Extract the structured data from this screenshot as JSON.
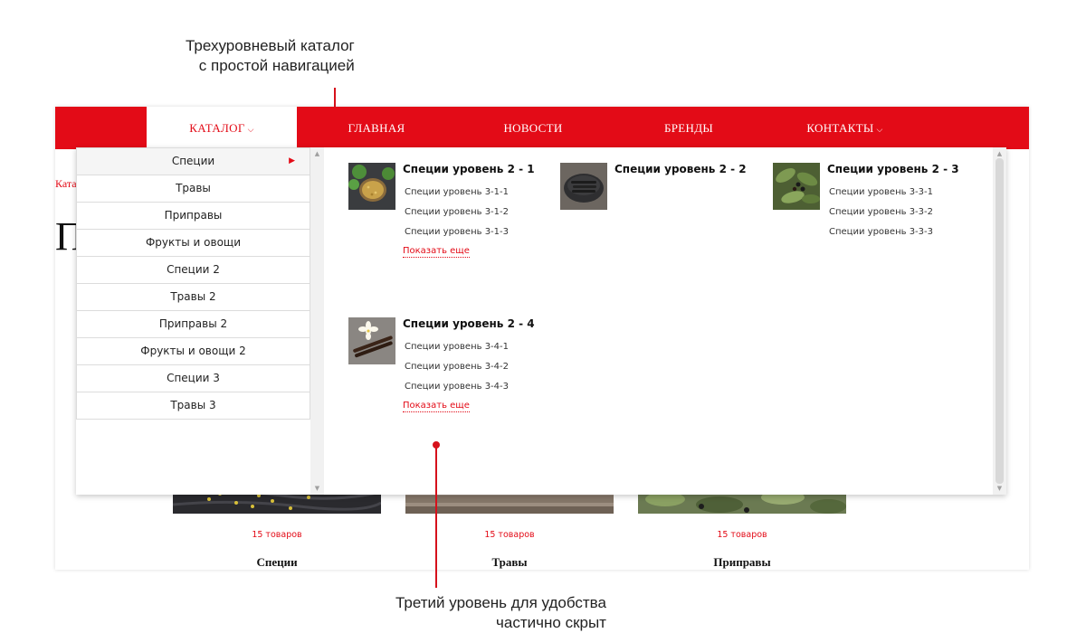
{
  "annotations": {
    "top_line1": "Трехуровневый каталог",
    "top_line2": "с простой навигацией",
    "bottom_line1": "Третий уровень для удобства",
    "bottom_line2": "частично скрыт"
  },
  "colors": {
    "brand": "#e30b17",
    "text": "#222222",
    "border": "#dcdcdc"
  },
  "nav": {
    "catalog": "КАТАЛОГ",
    "home": "ГЛАВНАЯ",
    "news": "НОВОСТИ",
    "brands": "БРЕНДЫ",
    "contacts": "КОНТАКТЫ"
  },
  "background": {
    "breadcrumb": "Ката",
    "heading": "П",
    "cards": [
      {
        "count": "15 товаров",
        "name": "Специи"
      },
      {
        "count": "15 товаров",
        "name": "Травы"
      },
      {
        "count": "15 товаров",
        "name": "Приправы"
      }
    ]
  },
  "menu": {
    "level1": [
      "Специи",
      "Травы",
      "Приправы",
      "Фрукты и овощи",
      "Специи 2",
      "Травы 2",
      "Приправы 2",
      "Фрукты и овощи 2",
      "Специи 3",
      "Травы 3"
    ],
    "active_index": 0,
    "level2": [
      {
        "title": "Специи уровень 2 - 1",
        "items": [
          "Специи уровень 3-1-1",
          "Специи уровень 3-1-2",
          "Специи уровень 3-1-3"
        ],
        "more": "Показать еще"
      },
      {
        "title": "Специи уровень 2 - 2",
        "items": []
      },
      {
        "title": "Специи уровень 2 - 3",
        "items": [
          "Специи уровень 3-3-1",
          "Специи уровень 3-3-2",
          "Специи уровень 3-3-3"
        ]
      },
      {
        "title": "Специи уровень 2 - 4",
        "items": [
          "Специи уровень 3-4-1",
          "Специи уровень 3-4-2",
          "Специи уровень 3-4-3"
        ],
        "more": "Показать еще"
      }
    ]
  },
  "icons": {
    "dropdown": "chevron-down-icon",
    "submenu": "arrow-right-icon"
  }
}
